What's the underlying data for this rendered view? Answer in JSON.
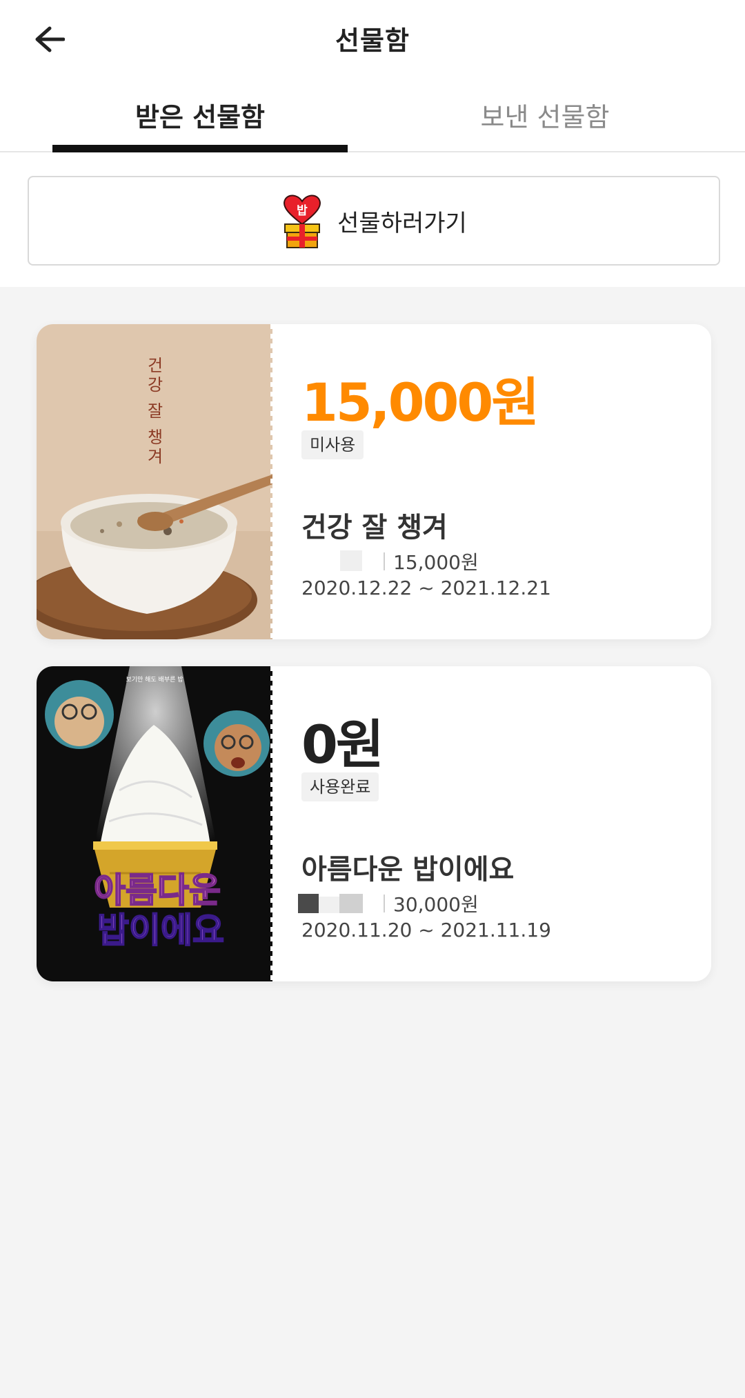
{
  "header": {
    "title": "선물함"
  },
  "tabs": [
    {
      "label": "받은 선물함",
      "active": true
    },
    {
      "label": "보낸 선물함",
      "active": false
    }
  ],
  "gift_button": {
    "label": "선물하러가기",
    "icon_text": "밥"
  },
  "colors": {
    "accent_orange": "#ff8a00",
    "text_dark": "#222222",
    "tab_inactive": "#8a8a8a",
    "background": "#f4f4f4"
  },
  "gifts": [
    {
      "amount": "15,000원",
      "status": "미사용",
      "name": "건강 잘 챙겨",
      "price": "15,000원",
      "period": "2020.12.22 ~ 2021.12.21",
      "image_text": "건강 잘 챙겨"
    },
    {
      "amount": "0원",
      "status": "사용완료",
      "name": "아름다운 밥이에요",
      "price": "30,000원",
      "period": "2020.11.20 ~ 2021.11.19",
      "image_caption": "보기만 해도 배부른 밥",
      "image_text_line1": "아름다운",
      "image_text_line2": "밥이에요"
    }
  ]
}
